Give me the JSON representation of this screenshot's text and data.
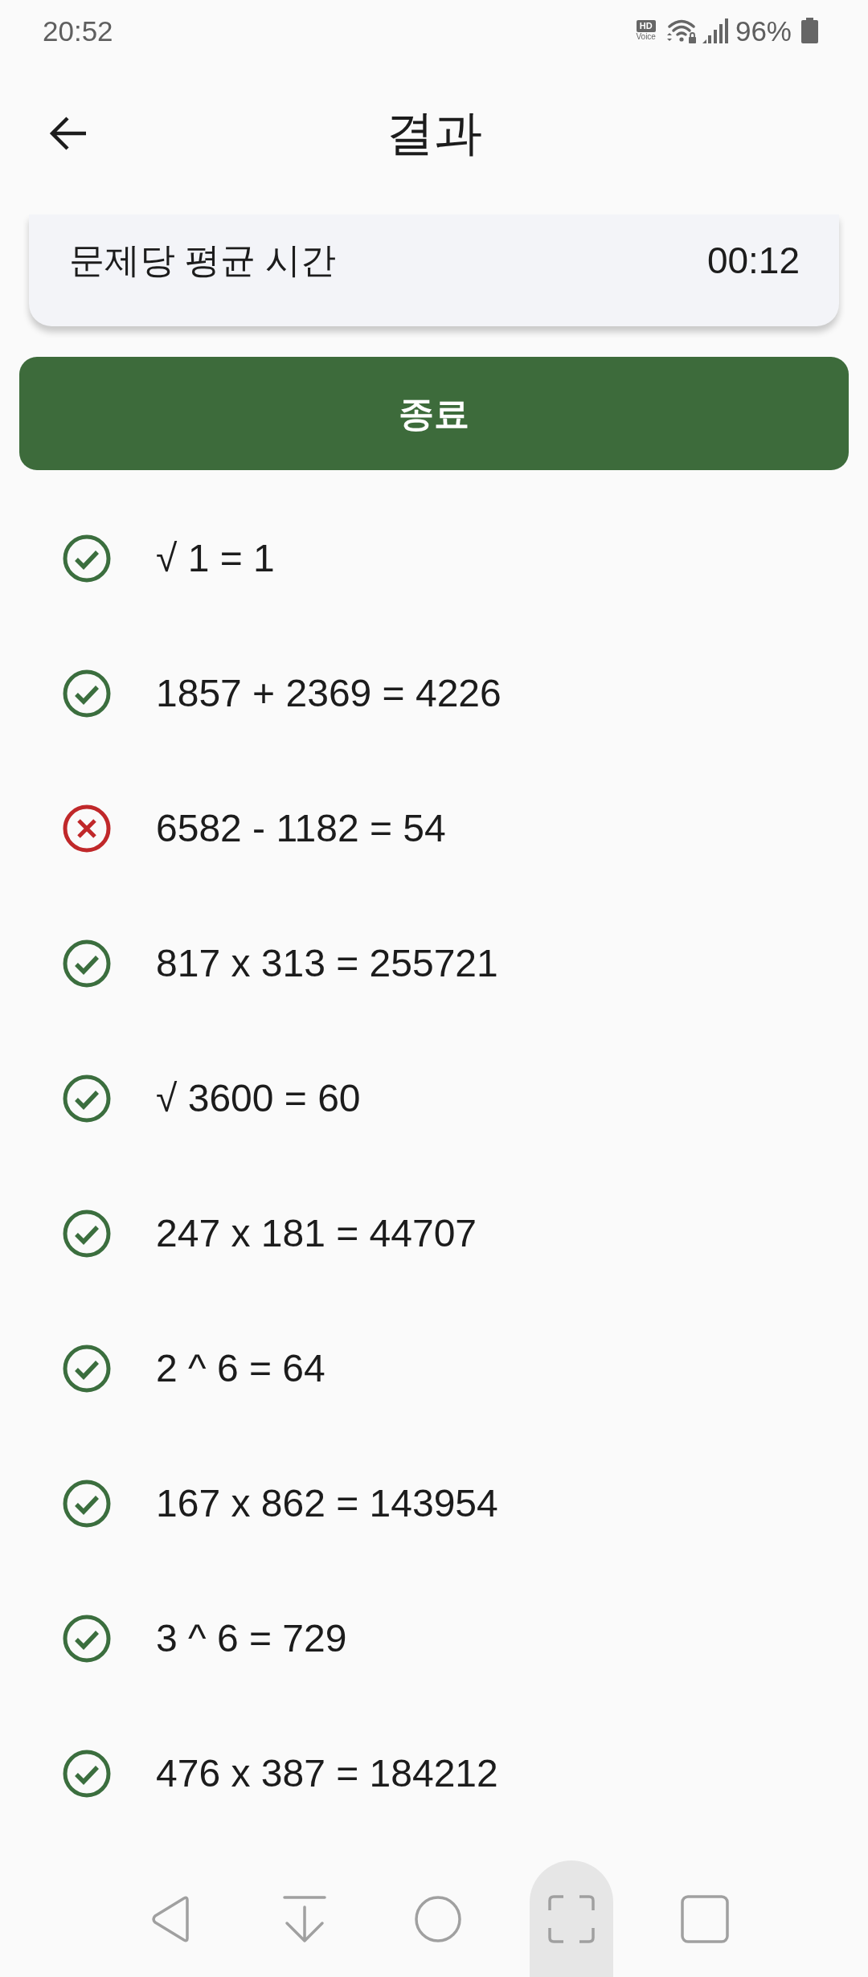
{
  "status_bar": {
    "time": "20:52",
    "hd_voice": {
      "top": "HD",
      "bottom": "Voice"
    },
    "battery": "96%"
  },
  "header": {
    "title": "결과"
  },
  "summary_card": {
    "label": "문제당 평균 시간",
    "value": "00:12"
  },
  "finish_button": {
    "label": "종료"
  },
  "results": [
    {
      "expression": "√ 1 = 1",
      "correct": true
    },
    {
      "expression": "1857 + 2369 = 4226",
      "correct": true
    },
    {
      "expression": "6582 - 1182 = 54",
      "correct": false
    },
    {
      "expression": "817 x 313 = 255721",
      "correct": true
    },
    {
      "expression": "√ 3600 = 60",
      "correct": true
    },
    {
      "expression": "247 x 181 = 44707",
      "correct": true
    },
    {
      "expression": "2 ^ 6 = 64",
      "correct": true
    },
    {
      "expression": "167 x 862 = 143954",
      "correct": true
    },
    {
      "expression": "3 ^ 6 = 729",
      "correct": true
    },
    {
      "expression": "476 x 387 = 184212",
      "correct": true
    }
  ],
  "nav_bar": {
    "buttons": [
      {
        "kind": "back",
        "selected": false
      },
      {
        "kind": "download",
        "selected": false
      },
      {
        "kind": "home",
        "selected": false
      },
      {
        "kind": "capture",
        "selected": true
      },
      {
        "kind": "recents",
        "selected": false
      }
    ]
  }
}
